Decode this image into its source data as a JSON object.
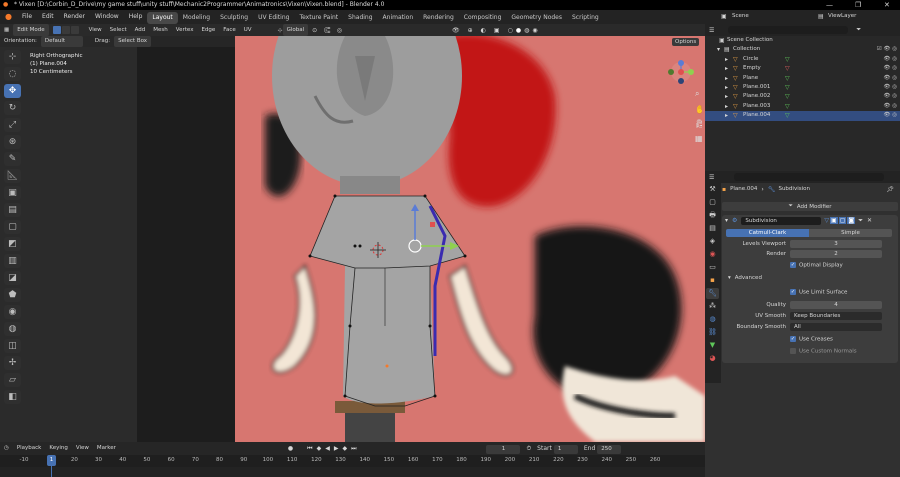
{
  "window": {
    "title": "* Vixen [D:\\Corbin_D_Drive\\my game stuff\\unity stuff\\Mechanic2Programmer\\Animatronics\\Vixen\\Vixen.blend] - Blender 4.0",
    "controls": [
      "—",
      "❐",
      "✕"
    ]
  },
  "menu": {
    "items": [
      "File",
      "Edit",
      "Render",
      "Window",
      "Help"
    ],
    "workspaces": [
      "Layout",
      "Modeling",
      "Sculpting",
      "UV Editing",
      "Texture Paint",
      "Shading",
      "Animation",
      "Rendering",
      "Compositing",
      "Geometry Nodes",
      "Scripting"
    ],
    "active_workspace": "Layout",
    "scene_label": "Scene",
    "view_layer_label": "ViewLayer"
  },
  "viewport_header": {
    "mode": "Edit Mode",
    "menus": [
      "View",
      "Select",
      "Add",
      "Mesh",
      "Vertex",
      "Edge",
      "Face",
      "UV"
    ],
    "orientation_dropdown": "Global",
    "options_label": "Options"
  },
  "tool_settings": {
    "orientation_label": "Orientation:",
    "orientation_value": "Default",
    "drag_label": "Drag:",
    "drag_value": "Select Box"
  },
  "viewport_info": {
    "line1": "Right Orthographic",
    "line2": "(1) Plane.004",
    "line3": "10 Centimeters"
  },
  "toolbar": {
    "tools": [
      "cursor-icon",
      "select-box-icon",
      "move-icon",
      "rotate-icon",
      "scale-icon",
      "transform-icon",
      "annotate-icon",
      "measure-icon",
      "add-cube-icon",
      "extrude-icon",
      "inset-icon",
      "bevel-icon",
      "loop-cut-icon",
      "knife-icon",
      "poly-build-icon",
      "spin-icon",
      "smooth-icon",
      "edge-slide-icon",
      "shrink-icon",
      "shear-icon",
      "rip-icon"
    ],
    "active_index": 2
  },
  "outliner": {
    "scene_collection": "Scene Collection",
    "collection": "Collection",
    "items": [
      {
        "name": "Circle",
        "color": "#e59f45",
        "modifier": "#5fc75a"
      },
      {
        "name": "Empty",
        "color": "#e59f45",
        "modifier": "#e06060"
      },
      {
        "name": "Plane",
        "color": "#e59f45",
        "modifier": "#5fc75a"
      },
      {
        "name": "Plane.001",
        "color": "#e59f45",
        "modifier": "#5fc75a"
      },
      {
        "name": "Plane.002",
        "color": "#e59f45",
        "modifier": "#5fc75a"
      },
      {
        "name": "Plane.003",
        "color": "#e59f45",
        "modifier": "#5fc75a"
      },
      {
        "name": "Plane.004",
        "color": "#e59f45",
        "modifier": "#5fc75a",
        "selected": true
      }
    ]
  },
  "properties": {
    "object_name": "Plane.004",
    "modifier_context": "Subdivision",
    "add_modifier": "Add Modifier",
    "modifier_name": "Subdivision",
    "mode_tabs": [
      "Catmull-Clark",
      "Simple"
    ],
    "levels_viewport_label": "Levels Viewport",
    "levels_viewport_value": "3",
    "render_label": "Render",
    "render_value": "2",
    "optimal_display": "Optimal Display",
    "advanced_label": "Advanced",
    "use_limit_surface": "Use Limit Surface",
    "quality_label": "Quality",
    "quality_value": "4",
    "uv_smooth_label": "UV Smooth",
    "uv_smooth_value": "Keep Boundaries",
    "boundary_smooth_label": "Boundary Smooth",
    "boundary_smooth_value": "All",
    "use_creases": "Use Creases",
    "use_custom_normals": "Use Custom Normals"
  },
  "timeline": {
    "menus": [
      "Playback",
      "Keying",
      "View",
      "Marker"
    ],
    "current_frame": "1",
    "start_label": "Start",
    "start_value": "1",
    "end_label": "End",
    "end_value": "250",
    "ruler": [
      "-10",
      "10",
      "20",
      "30",
      "40",
      "50",
      "60",
      "70",
      "80",
      "90",
      "100",
      "110",
      "120",
      "130",
      "140",
      "150",
      "160",
      "170",
      "180",
      "190",
      "200",
      "210",
      "220",
      "230",
      "240",
      "250",
      "260"
    ]
  },
  "colors": {
    "accent": "#4772b3",
    "background_pink": "#d77670",
    "selection": "#334d80"
  }
}
